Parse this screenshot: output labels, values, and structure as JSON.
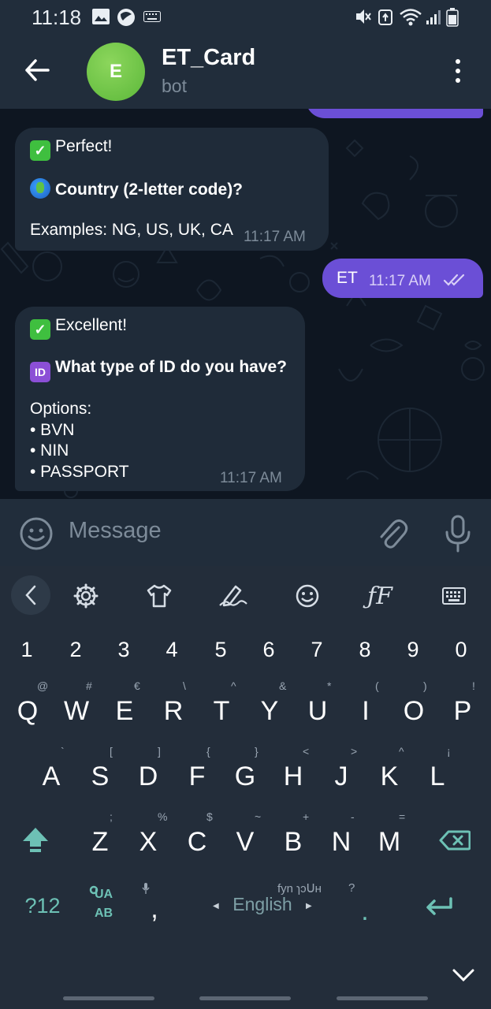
{
  "status_bar": {
    "time": "11:18",
    "left_icons": [
      "gallery-icon",
      "browser-icon",
      "keyboard-icon"
    ],
    "right_icons": [
      "mute-icon",
      "data-saver-icon",
      "wifi-icon",
      "signal-icon",
      "battery-icon"
    ]
  },
  "header": {
    "avatar_letter": "E",
    "title": "ET_Card",
    "subtitle": "bot"
  },
  "messages": [
    {
      "direction": "in",
      "lines": [
        {
          "emoji": "check-mark-icon",
          "text": "Perfect!"
        },
        {
          "text": ""
        },
        {
          "emoji": "globe-icon",
          "text": "Country (2-letter code)?",
          "bold": true
        },
        {
          "text": ""
        },
        {
          "text": "Examples: NG, US, UK, CA"
        }
      ],
      "time": "11:17 AM"
    },
    {
      "direction": "out",
      "lines": [
        {
          "text": "ET"
        }
      ],
      "time": "11:17 AM",
      "read_status": "double-check-icon"
    },
    {
      "direction": "in",
      "lines": [
        {
          "emoji": "check-mark-icon",
          "text": "Excellent!"
        },
        {
          "text": ""
        },
        {
          "emoji": "id-icon",
          "emoji_text": "ID",
          "text": "What type of ID do you have?",
          "bold": true
        },
        {
          "text": ""
        },
        {
          "text": "Options:"
        },
        {
          "text": "• BVN"
        },
        {
          "text": "• NIN"
        },
        {
          "text": "• PASSPORT"
        }
      ],
      "time": "11:17 AM"
    }
  ],
  "input": {
    "placeholder": "Message"
  },
  "keyboard": {
    "number_row": [
      "1",
      "2",
      "3",
      "4",
      "5",
      "6",
      "7",
      "8",
      "9",
      "0"
    ],
    "row1": [
      {
        "key": "Q",
        "hint": "@"
      },
      {
        "key": "W",
        "hint": "#"
      },
      {
        "key": "E",
        "hint": "€"
      },
      {
        "key": "R",
        "hint": "\\"
      },
      {
        "key": "T",
        "hint": "^"
      },
      {
        "key": "Y",
        "hint": "&"
      },
      {
        "key": "U",
        "hint": "*"
      },
      {
        "key": "I",
        "hint": "("
      },
      {
        "key": "O",
        "hint": ")"
      },
      {
        "key": "P",
        "hint": "!"
      }
    ],
    "row2": [
      {
        "key": "A",
        "hint": "`"
      },
      {
        "key": "S",
        "hint": "["
      },
      {
        "key": "D",
        "hint": "]"
      },
      {
        "key": "F",
        "hint": "{"
      },
      {
        "key": "G",
        "hint": "}"
      },
      {
        "key": "H",
        "hint": "<"
      },
      {
        "key": "J",
        "hint": ">"
      },
      {
        "key": "K",
        "hint": "^"
      },
      {
        "key": "L",
        "hint": "¡"
      }
    ],
    "row3": [
      {
        "key": "Z",
        "hint": ";"
      },
      {
        "key": "X",
        "hint": "%"
      },
      {
        "key": "C",
        "hint": "$"
      },
      {
        "key": "V",
        "hint": "~"
      },
      {
        "key": "B",
        "hint": "+"
      },
      {
        "key": "N",
        "hint": "-"
      },
      {
        "key": "M",
        "hint": "="
      }
    ],
    "symbols_label": "?12",
    "translate_top": "UA",
    "translate_bottom": "AB",
    "comma": ",",
    "space_label": "English",
    "space_hints": "fyn ɿɔᑌʜ",
    "period_hint": "?",
    "period": ".",
    "accent_color": "#6dc1b5"
  },
  "colors": {
    "header_bg": "#212d3b",
    "chat_bg": "#0e1621",
    "incoming_bubble": "#1f2b39",
    "outgoing_bubble": "#6b4fd6",
    "keyboard_bg": "#232d3a"
  }
}
